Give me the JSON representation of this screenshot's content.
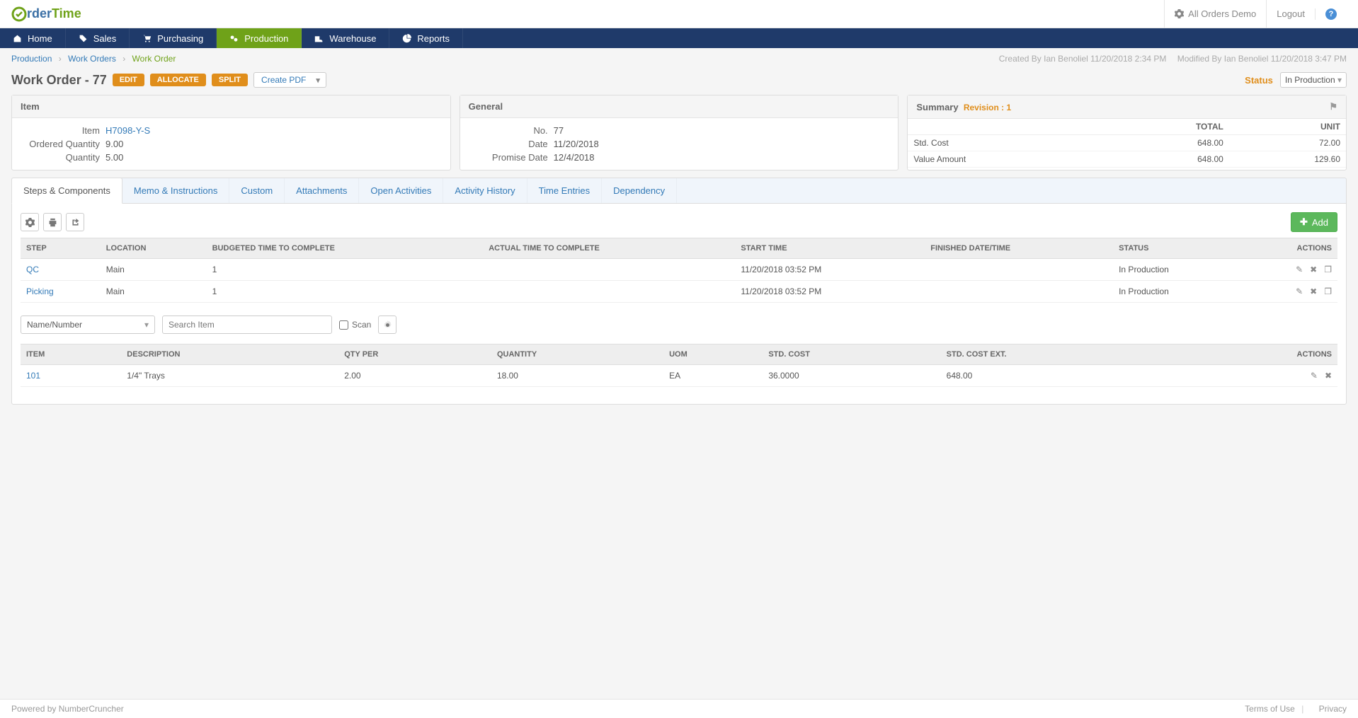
{
  "brand": {
    "o": "O",
    "rder": "rder",
    "time": "Time"
  },
  "top": {
    "demo": "All Orders Demo",
    "logout": "Logout"
  },
  "nav": {
    "home": "Home",
    "sales": "Sales",
    "purchasing": "Purchasing",
    "production": "Production",
    "warehouse": "Warehouse",
    "reports": "Reports"
  },
  "breadcrumbs": {
    "production": "Production",
    "work_orders": "Work Orders",
    "work_order": "Work Order"
  },
  "audit": {
    "created": "Created By Ian Benoliel 11/20/2018 2:34 PM",
    "modified": "Modified By Ian Benoliel 11/20/2018 3:47 PM"
  },
  "page_title": "Work Order - 77",
  "buttons": {
    "edit": "EDIT",
    "allocate": "ALLOCATE",
    "split": "SPLIT",
    "create_pdf": "Create PDF",
    "add": "Add"
  },
  "status": {
    "label": "Status",
    "value": "In Production"
  },
  "panels": {
    "item": {
      "title": "Item",
      "item_label": "Item",
      "item_value": "H7098-Y-S",
      "ordered_qty_label": "Ordered Quantity",
      "ordered_qty_value": "9.00",
      "qty_label": "Quantity",
      "qty_value": "5.00"
    },
    "general": {
      "title": "General",
      "no_label": "No.",
      "no_value": "77",
      "date_label": "Date",
      "date_value": "11/20/2018",
      "promise_label": "Promise Date",
      "promise_value": "12/4/2018"
    },
    "summary": {
      "title": "Summary",
      "revision": "Revision : 1",
      "col_total": "TOTAL",
      "col_unit": "UNIT",
      "rows": [
        {
          "label": "Std. Cost",
          "total": "648.00",
          "unit": "72.00"
        },
        {
          "label": "Value Amount",
          "total": "648.00",
          "unit": "129.60"
        }
      ]
    }
  },
  "tabs": {
    "steps": "Steps & Components",
    "memo": "Memo & Instructions",
    "custom": "Custom",
    "attachments": "Attachments",
    "open": "Open Activities",
    "history": "Activity History",
    "time": "Time Entries",
    "dependency": "Dependency"
  },
  "steps_table": {
    "headers": {
      "step": "STEP",
      "location": "LOCATION",
      "budgeted": "BUDGETED TIME TO COMPLETE",
      "actual": "ACTUAL TIME TO COMPLETE",
      "start": "START TIME",
      "finished": "FINISHED DATE/TIME",
      "status": "STATUS",
      "actions": "ACTIONS"
    },
    "rows": [
      {
        "step": "QC",
        "location": "Main",
        "budgeted": "1",
        "actual": "",
        "start": "11/20/2018 03:52 PM",
        "finished": "",
        "status": "In Production"
      },
      {
        "step": "Picking",
        "location": "Main",
        "budgeted": "1",
        "actual": "",
        "start": "11/20/2018 03:52 PM",
        "finished": "",
        "status": "In Production"
      }
    ]
  },
  "search": {
    "mode": "Name/Number",
    "placeholder": "Search Item",
    "scan": "Scan"
  },
  "components_table": {
    "headers": {
      "item": "ITEM",
      "description": "DESCRIPTION",
      "qty_per": "QTY PER",
      "quantity": "QUANTITY",
      "uom": "UOM",
      "std_cost": "STD. COST",
      "std_cost_ext": "STD. COST EXT.",
      "actions": "ACTIONS"
    },
    "rows": [
      {
        "item": "101",
        "description": "1/4\" Trays",
        "qty_per": "2.00",
        "quantity": "18.00",
        "uom": "EA",
        "std_cost": "36.0000",
        "std_cost_ext": "648.00"
      }
    ]
  },
  "footer": {
    "powered": "Powered by NumberCruncher",
    "tou": "Terms of Use",
    "privacy": "Privacy"
  }
}
